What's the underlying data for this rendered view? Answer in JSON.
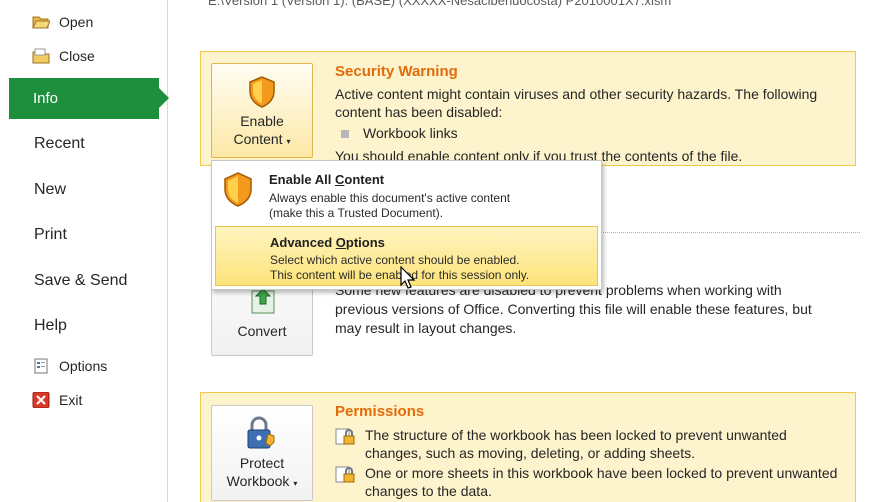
{
  "top_path_text": "E:\\Version 1 (Version 1). (BASE) (XXXXX-Nesacibenuocosta) P2010001X7.xlsm",
  "nav": {
    "open": "Open",
    "close": "Close",
    "info": "Info",
    "recent": "Recent",
    "new": "New",
    "print": "Print",
    "save_send": "Save & Send",
    "help": "Help",
    "options": "Options",
    "exit": "Exit"
  },
  "security": {
    "button_line1": "Enable",
    "button_line2": "Content",
    "title": "Security Warning",
    "text_line1": "Active content might contain viruses and other security hazards. The following",
    "text_line2": "content has been disabled:",
    "bullet_item": "Workbook links",
    "advice": "You should enable content only if you trust the contents of the file."
  },
  "dropdown": {
    "item1_title_pre": "Enable All ",
    "item1_title_key": "C",
    "item1_title_post": "ontent",
    "item1_desc1": "Always enable this document's active content",
    "item1_desc2": "(make this a Trusted Document).",
    "item2_title_pre": "Advanced ",
    "item2_title_key": "O",
    "item2_title_post": "ptions",
    "item2_desc1": "Select which active content should be enabled.",
    "item2_desc2": "This content will be enabled for this session only."
  },
  "convert": {
    "button_label": "Convert",
    "text_line1": "Some new features are disabled to prevent problems when working with",
    "text_line2": "previous versions of Office. Converting this file will enable these features, but",
    "text_line3": "may result in layout changes."
  },
  "permissions": {
    "button_line1": "Protect",
    "button_line2": "Workbook",
    "title": "Permissions",
    "row1_line1": "The structure of the workbook has been locked to prevent unwanted",
    "row1_line2": "changes, such as moving, deleting, or adding sheets.",
    "row2_line1": "One or more sheets in this workbook have been locked to prevent unwanted",
    "row2_line2": "changes to the data."
  },
  "colors": {
    "nav_active": "#1e8f3d",
    "panel_bg": "#fdf3cc",
    "panel_border": "#f2c84b",
    "title_orange": "#e26b0a"
  },
  "icons": [
    "folder-open-icon",
    "folder-close-icon",
    "options-icon",
    "exit-icon",
    "shield-icon",
    "convert-icon",
    "lock-icon",
    "mouse-cursor-icon"
  ]
}
